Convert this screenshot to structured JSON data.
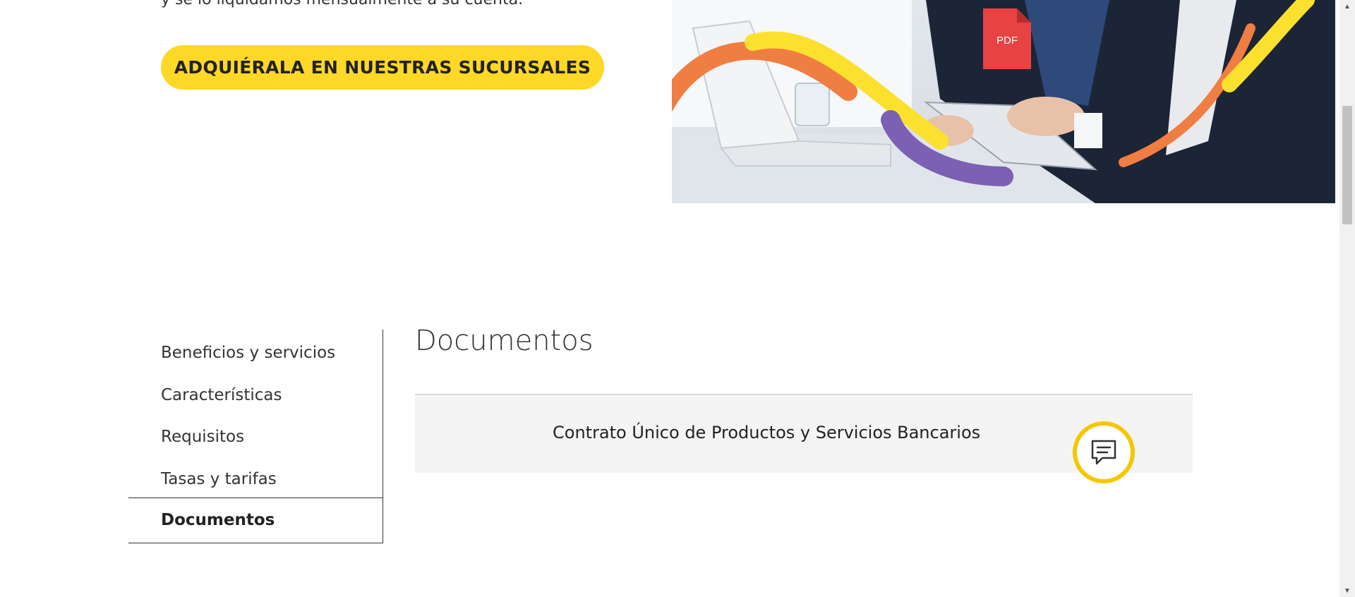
{
  "hero": {
    "text": "y se lo liquidamos mensualmente a su cuenta.",
    "cta_label": "ADQUIÉRALA EN NUESTRAS SUCURSALES"
  },
  "side_nav": {
    "items": [
      {
        "label": "Beneficios y servicios"
      },
      {
        "label": "Características"
      },
      {
        "label": "Requisitos"
      },
      {
        "label": "Tasas y tarifas"
      }
    ],
    "active_label": "Documentos"
  },
  "documents": {
    "title": "Documentos",
    "items": [
      {
        "label": "Contrato Único de Productos y Servicios Bancarios",
        "file_type": "PDF"
      }
    ]
  },
  "icons": {
    "pdf": "pdf-file-icon",
    "chat": "chat-bubble-icon"
  },
  "colors": {
    "accent_yellow": "#fdd826",
    "pdf_red": "#e84242",
    "chat_ring": "#f7c600"
  }
}
